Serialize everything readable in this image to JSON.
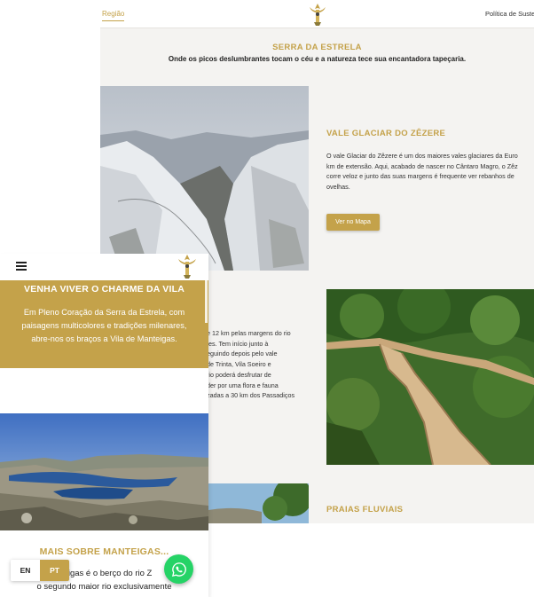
{
  "desktop": {
    "nav": {
      "regiao": "Região",
      "politica": "Política de Suste"
    },
    "serra": {
      "title": "SERRA DA ESTRELA",
      "subtitle": "Onde os picos deslumbrantes tocam o céu e a natureza tece sua encantadora tapeçaria."
    },
    "vale": {
      "title": "VALE GLACIAR DO ZÊZERE",
      "text": "O vale Glaciar do Zêzere é um dos maiores vales glaciares da Euro\nkm de extensão. Aqui, acabado de nascer no Cântaro Magro, o Zêz\ncorre veloz e junto das suas margens é frequente ver rebanhos de\novelhas.",
      "button": "Ver no Mapa"
    },
    "passadicos": {
      "text": "e 12 km pelas margens do rio\ntes. Tem início junto à\neguindo depois pelo vale\nde Trinta, Vila Soeiro e\nrio poderá desfrutar de\nder por uma flora e fauna\nzadas a 30 km dos Passadiços"
    },
    "praias": {
      "title": "PRAIAS FLUVIAIS"
    }
  },
  "mobile": {
    "charme": {
      "title": "VENHA VIVER O CHARME DA VILA",
      "text": "Em Pleno Coração da Serra da Estrela, com\npaisagens multicolores e tradições milenares,\nabre-nos os braços a Vila de Manteigas."
    },
    "mais": {
      "title": "MAIS SOBRE MANTEIGAS...",
      "text": "nteigas é o berço do rio Z\no segundo maior rio exclusivamente"
    },
    "lang": {
      "en": "EN",
      "pt": "PT"
    }
  },
  "colors": {
    "accent": "#c4a24a",
    "whatsapp": "#25d366"
  },
  "icons": {
    "menu": "hamburger-menu-icon",
    "chat": "whatsapp-icon",
    "logo": "manteigas-logo"
  }
}
